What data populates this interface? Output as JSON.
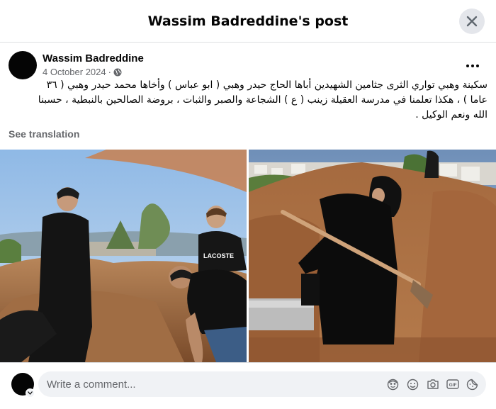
{
  "modal": {
    "title": "Wassim Badreddine's post"
  },
  "post": {
    "author": "Wassim Badreddine",
    "date": "4 October 2024",
    "privacy_icon": "globe-icon",
    "text_lines": [
      "سكينة وهبي  تواري الثرى  جثامين الشهيدين  أباها الحاج حيدر وهبي ( ابو عباس ) وأخاها محمد حيدر وهبي ( ٣٦",
      "عاما ) ، هكذا تعلمنا في مدرسة العقيلة زينب ( ع ) الشجاعة والصبر والثبات ،  بروضة الصالحين بالنبطية  ، حسبنا",
      "الله ونعم الوكيل ."
    ],
    "see_translation": "See translation"
  },
  "photos": [
    {
      "name": "photo-men-burial",
      "brand_text": "LACOSTE"
    },
    {
      "name": "photo-woman-shovel"
    }
  ],
  "comment": {
    "placeholder": "Write a comment...",
    "icons": [
      "avatar-sticker-icon",
      "emoji-icon",
      "camera-icon",
      "gif-icon",
      "sticker-icon"
    ]
  },
  "colors": {
    "secondary_text": "#65676b",
    "input_bg": "#f0f2f5",
    "divider": "#dddfe2"
  }
}
